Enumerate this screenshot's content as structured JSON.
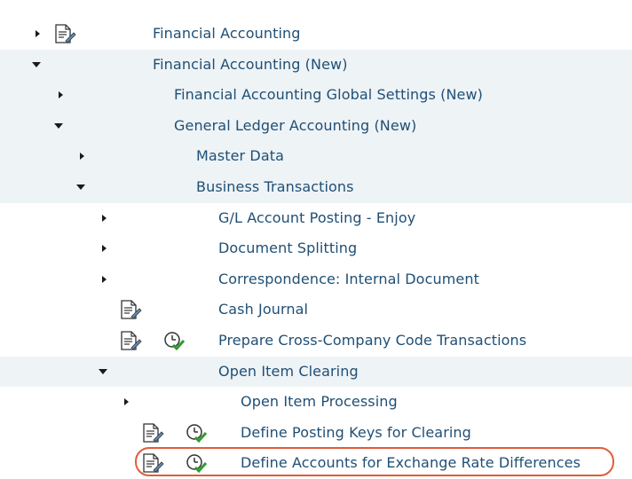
{
  "tree": {
    "rows": [
      {
        "label": "Financial Accounting",
        "expander": "collapsed",
        "doc_icon": true,
        "clock_icon": false
      },
      {
        "label": "Financial Accounting (New)",
        "expander": "expanded",
        "doc_icon": false,
        "clock_icon": false
      },
      {
        "label": "Financial Accounting Global Settings (New)",
        "expander": "collapsed",
        "doc_icon": false,
        "clock_icon": false
      },
      {
        "label": "General Ledger Accounting (New)",
        "expander": "expanded",
        "doc_icon": false,
        "clock_icon": false
      },
      {
        "label": "Master Data",
        "expander": "collapsed",
        "doc_icon": false,
        "clock_icon": false
      },
      {
        "label": "Business Transactions",
        "expander": "expanded",
        "doc_icon": false,
        "clock_icon": false
      },
      {
        "label": "G/L Account Posting - Enjoy",
        "expander": "collapsed",
        "doc_icon": false,
        "clock_icon": false
      },
      {
        "label": "Document Splitting",
        "expander": "collapsed",
        "doc_icon": false,
        "clock_icon": false
      },
      {
        "label": "Correspondence: Internal Document",
        "expander": "collapsed",
        "doc_icon": false,
        "clock_icon": false
      },
      {
        "label": "Cash Journal",
        "expander": "none",
        "doc_icon": true,
        "clock_icon": false
      },
      {
        "label": "Prepare Cross-Company Code Transactions",
        "expander": "none",
        "doc_icon": true,
        "clock_icon": true
      },
      {
        "label": "Open Item Clearing",
        "expander": "expanded",
        "doc_icon": false,
        "clock_icon": false
      },
      {
        "label": "Open Item Processing",
        "expander": "collapsed",
        "doc_icon": false,
        "clock_icon": false
      },
      {
        "label": "Define Posting Keys for Clearing",
        "expander": "none",
        "doc_icon": true,
        "clock_icon": true
      },
      {
        "label": "Define Accounts for Exchange Rate Differences",
        "expander": "none",
        "doc_icon": true,
        "clock_icon": true,
        "highlighted": true
      }
    ]
  },
  "icons": {
    "doc": "documentation-icon",
    "clock": "execute-clock-check-icon"
  },
  "colors": {
    "label": "#1f4f75",
    "row_shaded": "#eef3f6",
    "highlight": "#e25b3a"
  }
}
